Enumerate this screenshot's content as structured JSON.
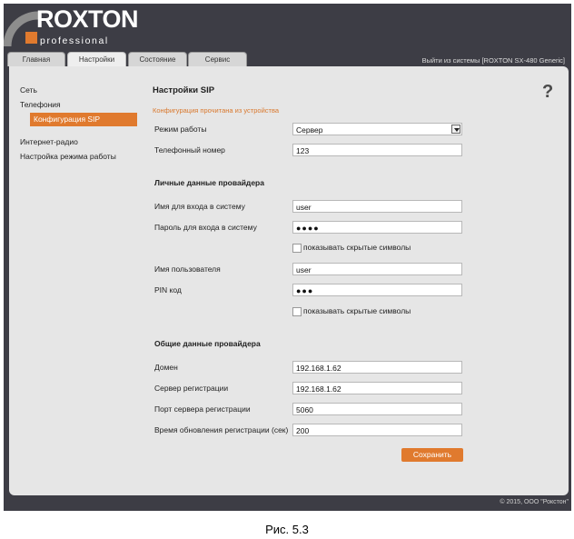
{
  "brand": {
    "name": "ROXTON",
    "tagline": "professional"
  },
  "tabs": [
    {
      "label": "Главная"
    },
    {
      "label": "Настройки"
    },
    {
      "label": "Состояние"
    },
    {
      "label": "Сервис"
    }
  ],
  "active_tab": "Настройки",
  "logout": "Выйти из системы [ROXTON SX-480 Generic]",
  "sidebar": {
    "items": [
      {
        "label": "Сеть"
      },
      {
        "label": "Телефония"
      },
      {
        "label": "Конфигурация SIP"
      },
      {
        "label": "Интернет-радио"
      },
      {
        "label": "Настройка режима работы"
      }
    ]
  },
  "page": {
    "title": "Настройки SIP",
    "status": "Конфигурация прочитана из устройства",
    "help": "?"
  },
  "form": {
    "mode": {
      "label": "Режим работы",
      "value": "Сервер"
    },
    "phone": {
      "label": "Телефонный номер",
      "value": "123"
    },
    "personal_section": "Личные данные провайдера",
    "login": {
      "label": "Имя для входа в систему",
      "value": "user"
    },
    "password": {
      "label": "Пароль для входа в систему",
      "value": "●●●●"
    },
    "show_hidden_1": "показывать скрытые символы",
    "username": {
      "label": "Имя пользователя",
      "value": "user"
    },
    "pin": {
      "label": "PIN код",
      "value": "●●●"
    },
    "show_hidden_2": "показывать скрытые символы",
    "common_section": "Общие данные провайдера",
    "domain": {
      "label": "Домен",
      "value": "192.168.1.62"
    },
    "reg_server": {
      "label": "Сервер регистрации",
      "value": "192.168.1.62"
    },
    "reg_port": {
      "label": "Порт сервера регистрации",
      "value": "5060"
    },
    "reg_refresh": {
      "label": "Время обновления регистрации (сек)",
      "value": "200"
    },
    "save": "Сохранить"
  },
  "footer": "© 2015, ООО \"Рокстон\"",
  "caption": "Рис. 5.3",
  "colors": {
    "accent": "#e07a2e",
    "frame": "#3d3d45",
    "panel": "#e6e6e6"
  }
}
